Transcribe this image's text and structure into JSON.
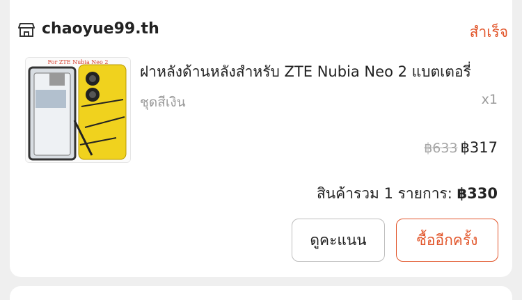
{
  "shop": {
    "name": "chaoyue99.th",
    "icon": "store-icon"
  },
  "order": {
    "status": "สำเร็จ"
  },
  "product": {
    "title": "ฝาหลังด้านหลังสำหรับ ZTE Nubia Neo 2 แบตเตอรี่",
    "variant": "ชุดสีเงิน",
    "quantity": "x1",
    "original_price": "฿633",
    "price": "฿317",
    "image_caption": "For ZTE Nubia Neo 2"
  },
  "summary": {
    "label": "สินค้ารวม 1 รายการ:",
    "amount": "฿330"
  },
  "actions": {
    "rate_label": "ดูคะแนน",
    "buy_again_label": "ซื้ออีกครั้ง"
  },
  "colors": {
    "accent": "#e2562b",
    "text": "#222222",
    "muted": "#9a9a9a"
  }
}
